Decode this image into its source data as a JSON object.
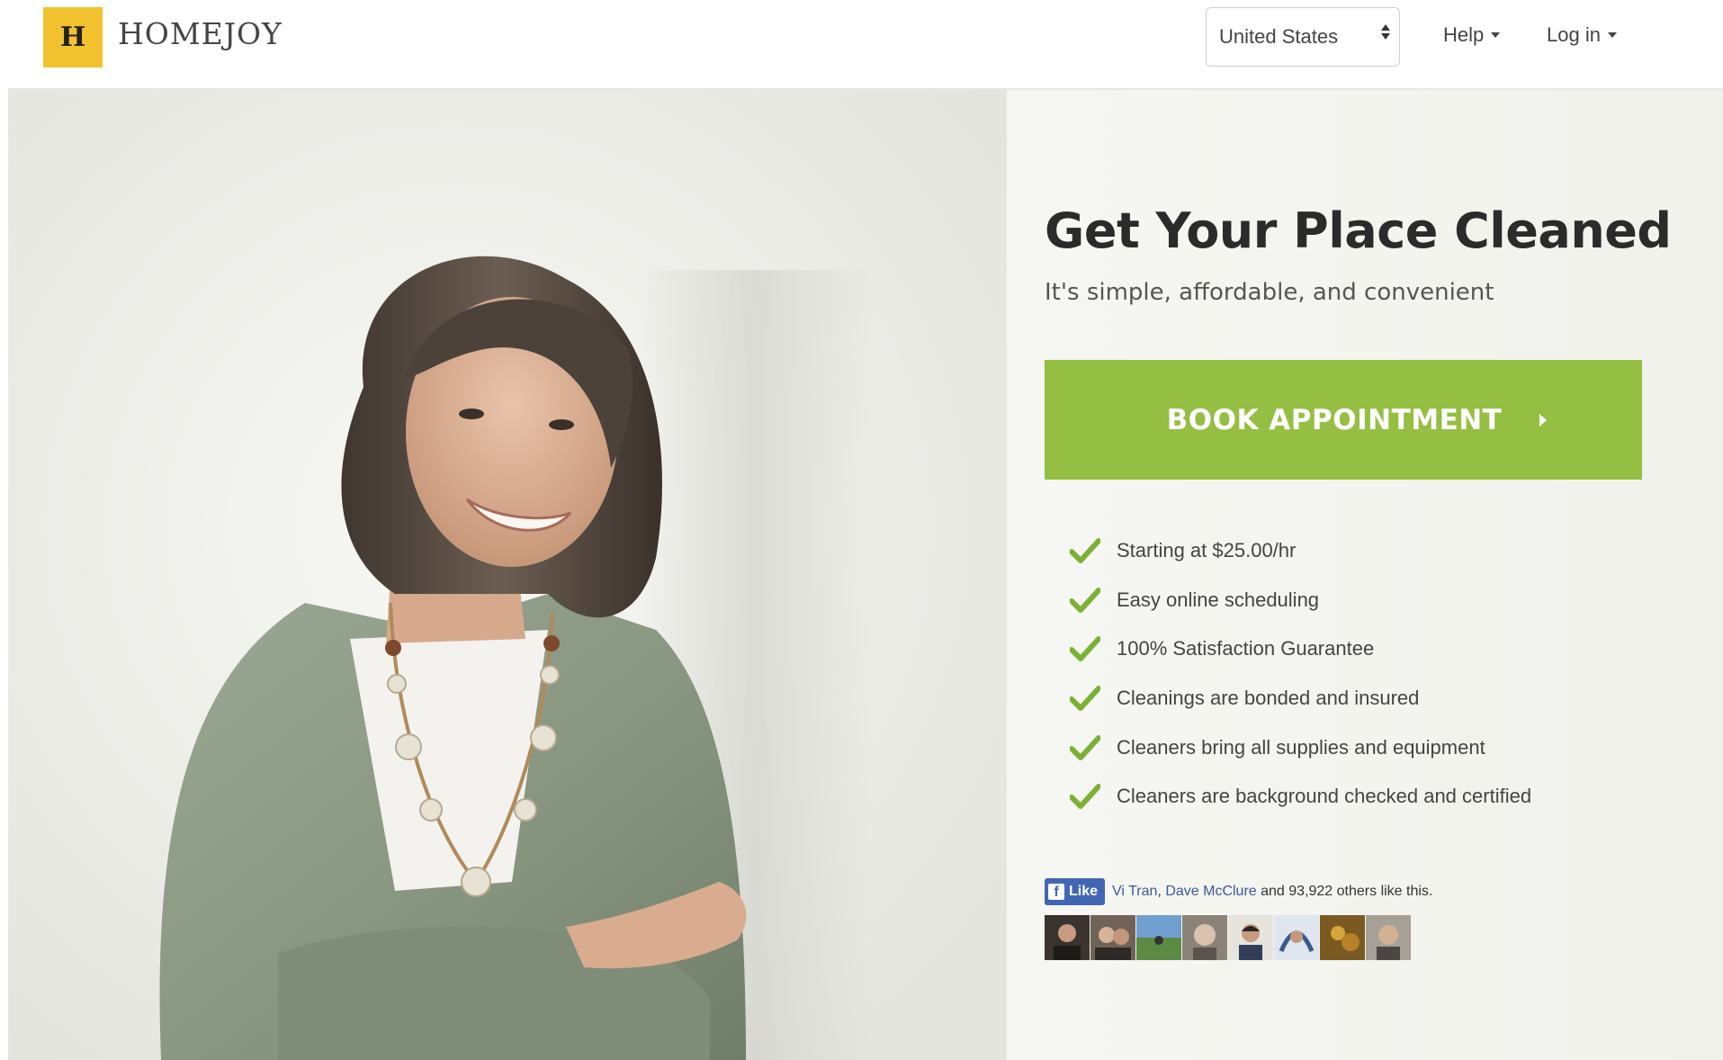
{
  "header": {
    "logo_letter": "H",
    "logo_text": "HOMEJOY",
    "country_select_value": "United States",
    "nav_help": "Help",
    "nav_login": "Log in"
  },
  "hero": {
    "title": "Get Your Place Cleaned",
    "subtitle": "It's simple, affordable, and convenient",
    "cta_label": "BOOK APPOINTMENT",
    "features": [
      "Starting at $25.00/hr",
      "Easy online scheduling",
      "100% Satisfaction Guarantee",
      "Cleanings are bonded and insured",
      "Cleaners bring all supplies and equipment",
      "Cleaners are background checked and certified"
    ],
    "facebook": {
      "like_label": "Like",
      "friend_1": "Vi Tran",
      "friend_2": "Dave McClure",
      "others_text": "and 93,922 others like this."
    }
  },
  "colors": {
    "brand_yellow": "#f2c12e",
    "cta_green": "#94bf43",
    "check_green": "#7bb236",
    "facebook_blue": "#4267b2"
  },
  "icons": [
    "logo-mark",
    "select-arrows-icon",
    "caret-down-icon",
    "check-icon",
    "facebook-icon",
    "chevron-right-icon"
  ]
}
